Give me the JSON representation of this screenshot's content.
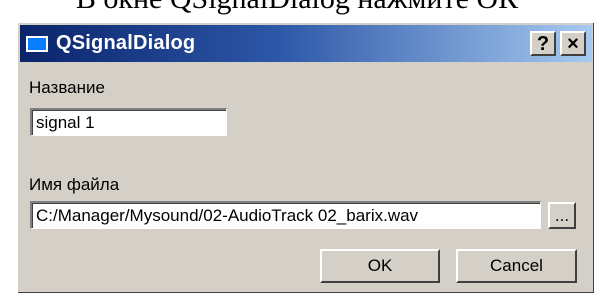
{
  "doc_caption": "В окне QSignalDialog нажмите ОК",
  "window": {
    "title": "QSignalDialog",
    "help_label": "?",
    "close_label": "×"
  },
  "form": {
    "name_label": "Название",
    "name_value": "signal 1",
    "file_label": "Имя файла",
    "file_value": "C:/Manager/Mysound/02-AudioTrack 02_barix.wav",
    "browse_label": "..."
  },
  "buttons": {
    "ok_label": "OK",
    "cancel_label": "Cancel"
  },
  "colors": {
    "titlebar_start": "#0a246a",
    "titlebar_end": "#a6caf0",
    "dialog_background": "#d4d0c8"
  },
  "icons": {
    "app": "window-icon",
    "help": "help-icon",
    "close": "close-icon"
  }
}
